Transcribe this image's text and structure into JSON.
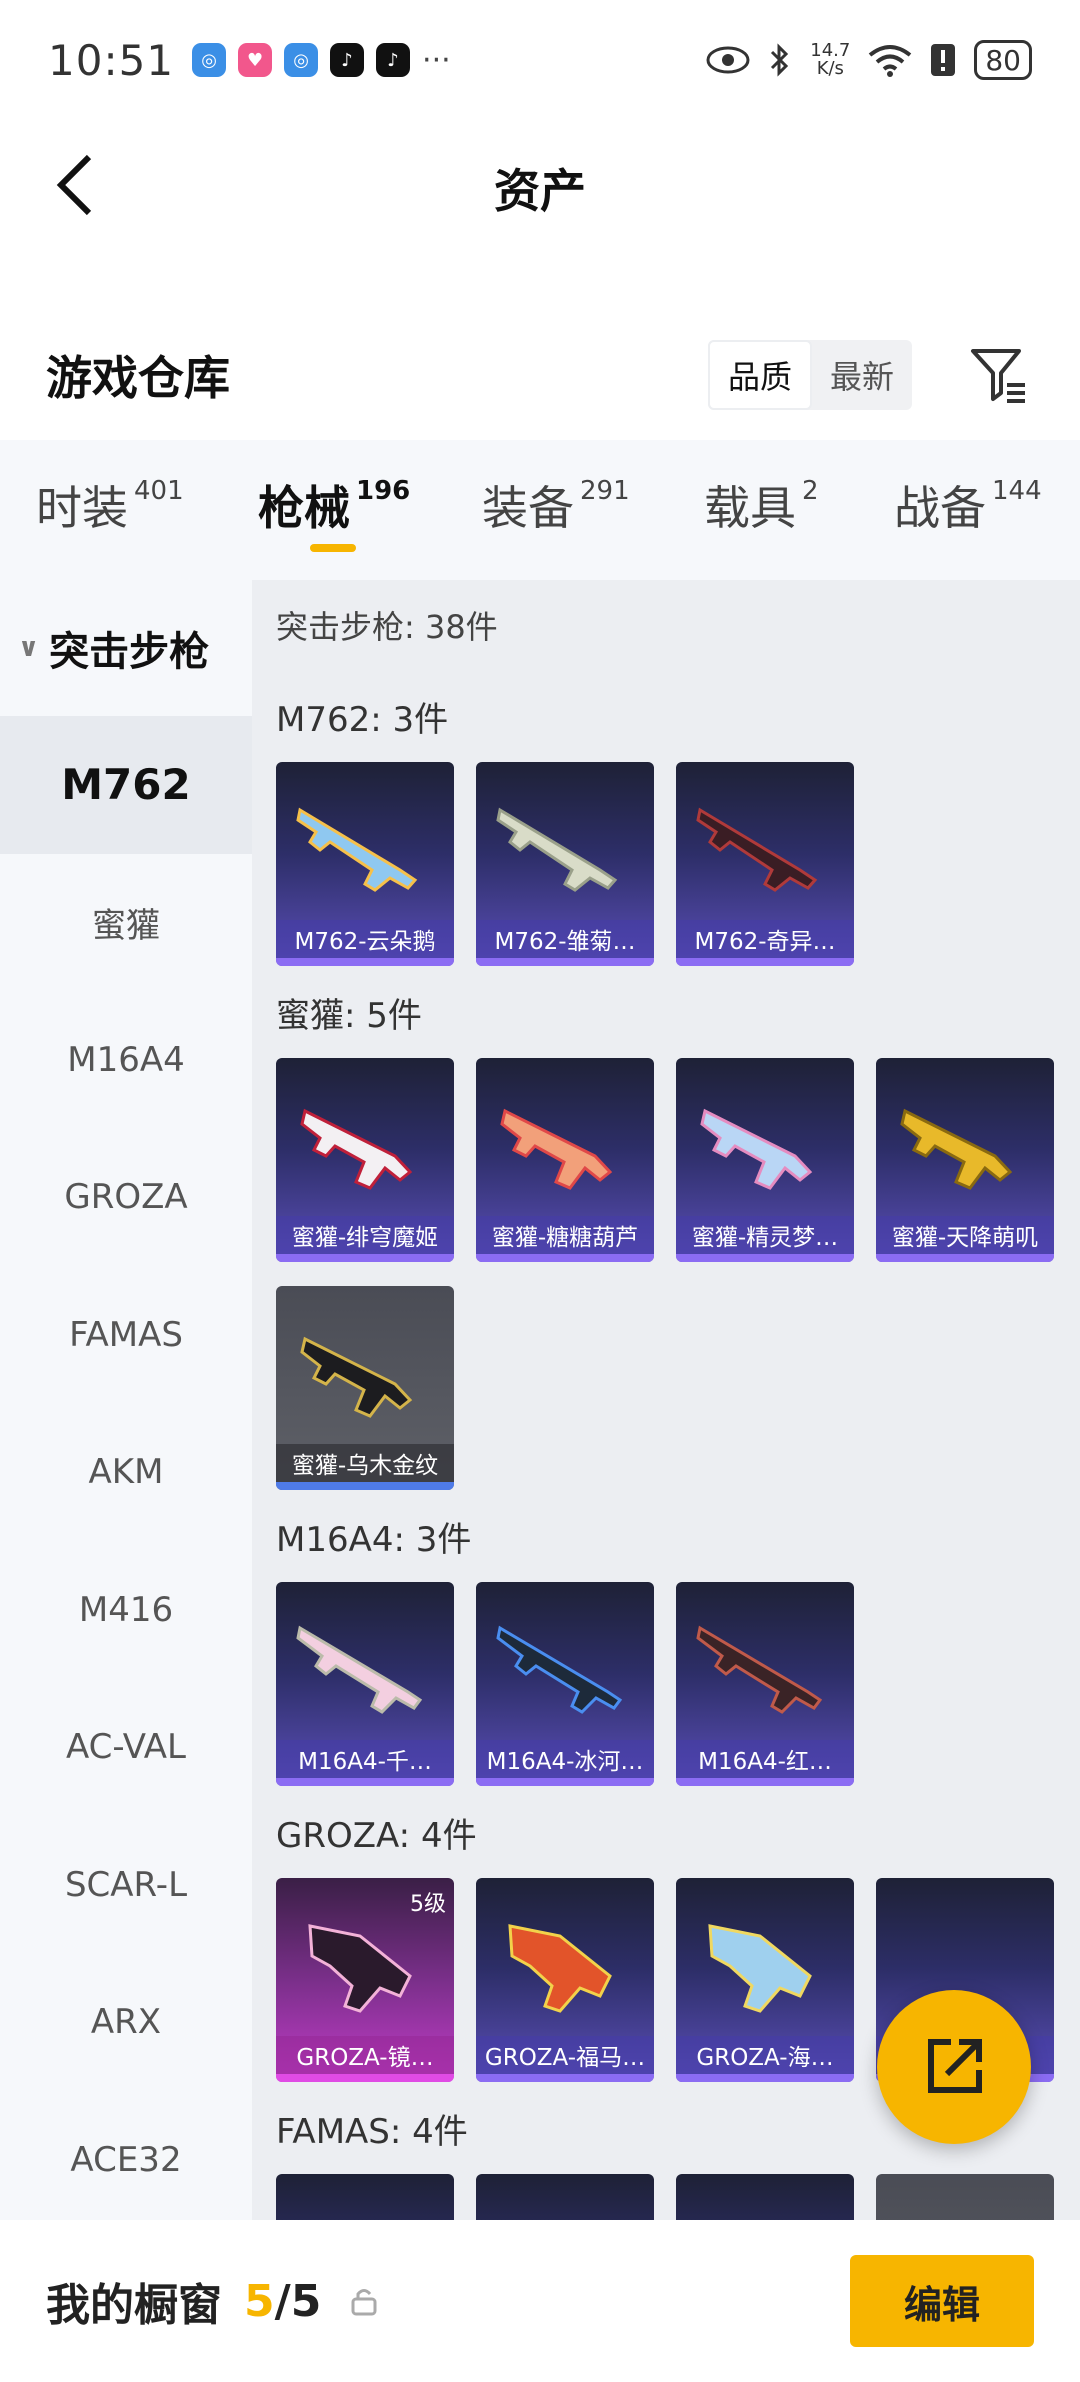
{
  "status_bar": {
    "time": "10:51",
    "speed_value": "14.7",
    "speed_unit": "K/s",
    "battery": "80",
    "more": "···"
  },
  "header": {
    "title": "资产"
  },
  "warehouse": {
    "title": "游戏仓库",
    "sort_options": [
      "品质",
      "最新"
    ],
    "active_sort": "品质"
  },
  "tabs": [
    {
      "label": "时装",
      "count": "401"
    },
    {
      "label": "枪械",
      "count": "196"
    },
    {
      "label": "装备",
      "count": "291"
    },
    {
      "label": "载具",
      "count": "2"
    },
    {
      "label": "战备",
      "count": "144"
    }
  ],
  "active_tab": "枪械",
  "sidebar": {
    "group": "突击步枪",
    "items": [
      "M762",
      "蜜獾",
      "M16A4",
      "GROZA",
      "FAMAS",
      "AKM",
      "M416",
      "AC-VAL",
      "SCAR-L",
      "ARX",
      "ACE32"
    ],
    "active": "M762"
  },
  "content": {
    "summary": "突击步枪: 38件",
    "sections": [
      {
        "title": "M762: 3件",
        "items": [
          "M762-云朵鹅",
          "M762-雏菊…",
          "M762-奇异…"
        ]
      },
      {
        "title": "蜜獾: 5件",
        "items": [
          "蜜獾-绯穹魔姬",
          "蜜獾-糖糖葫芦",
          "蜜獾-精灵梦…",
          "蜜獾-天降萌叽",
          "蜜獾-乌木金纹"
        ]
      },
      {
        "title": "M16A4: 3件",
        "items": [
          "M16A4-千…",
          "M16A4-冰河…",
          "M16A4-红…"
        ]
      },
      {
        "title": "GROZA: 4件",
        "items": [
          "GROZA-镜…",
          "GROZA-福马…",
          "GROZA-海…",
          ""
        ],
        "level_badge": "5级"
      },
      {
        "title": "FAMAS: 4件",
        "items": [
          "",
          "",
          "",
          ""
        ]
      }
    ]
  },
  "bottom_bar": {
    "title": "我的橱窗",
    "count_current": "5",
    "count_total": "/5",
    "edit_label": "编辑"
  },
  "colors": {
    "accent": "#f7b500",
    "card_purple": "#5b4fb8",
    "card_gray": "#5f6168",
    "card_pink": "#c23cc8"
  },
  "icons": [
    "back-arrow-icon",
    "filter-icon",
    "share-external-icon",
    "lock-icon",
    "eye-icon",
    "bluetooth-icon",
    "wifi-icon"
  ]
}
